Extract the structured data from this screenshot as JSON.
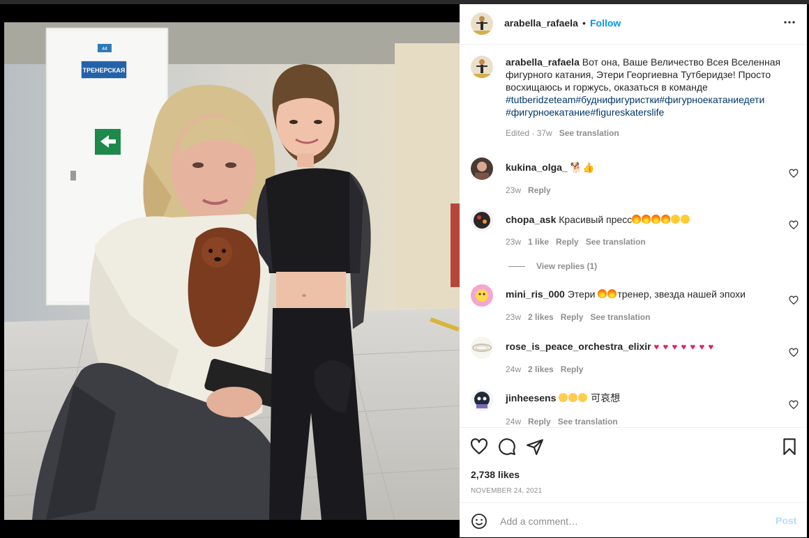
{
  "post": {
    "username": "arabella_rafaela",
    "dot": "•",
    "follow_label": "Follow",
    "caption_text": "Вот она, Ваше Величество Всея Вселенная фигурного катания, Этери Георгиевна Тутберидзе! Просто восхищаюсь и горжусь, оказаться в команде",
    "caption_tags": "#tutberidzeteam#буднифигуристки#фигурноекатаниедети #фигурноекатание#figureskaterslife",
    "caption_meta": "Edited · 37w",
    "see_translation": "See translation",
    "photo_sign_number": "44",
    "photo_sign_text": "ТРЕНЕРСКАЯ",
    "likes": "2,738 likes",
    "date": "NOVEMBER 24, 2021",
    "comment_placeholder": "Add a comment…",
    "post_label": "Post"
  },
  "comments": [
    {
      "username": "kukina_olga_",
      "text": "🐕👍",
      "age": "23w",
      "likes": "",
      "reply": "Reply",
      "translate": ""
    },
    {
      "username": "chopa_ask",
      "text": "Красивый пресс",
      "age": "23w",
      "likes": "1 like",
      "reply": "Reply",
      "translate": "See translation",
      "view_replies": "View replies (1)"
    },
    {
      "username": "mini_ris_000",
      "text_a": "Этери ",
      "text_b": "тренер, звезда нашей эпохи",
      "age": "23w",
      "likes": "2 likes",
      "reply": "Reply",
      "translate": "See translation"
    },
    {
      "username": "rose_is_peace_orchestra_elixir",
      "text": "",
      "age": "24w",
      "likes": "2 likes",
      "reply": "Reply",
      "translate": ""
    },
    {
      "username": "jinheesens",
      "text": " 可哀想",
      "age": "24w",
      "likes": "",
      "reply": "Reply",
      "translate": "See translation"
    }
  ],
  "icons": [
    "more-options-icon",
    "like-heart-icon",
    "comment-icon",
    "share-icon",
    "save-bookmark-icon",
    "emoji-icon",
    "comment-like-icon"
  ]
}
